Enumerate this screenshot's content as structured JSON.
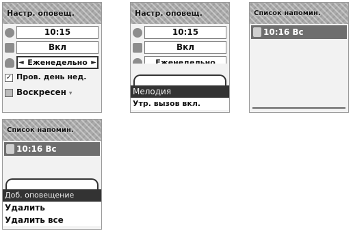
{
  "screens": {
    "s1": {
      "title": "Настр. оповещ.",
      "time": "10:15",
      "state": "Вкл",
      "repeat": "Еженедельно",
      "left_arrow": "◄",
      "right_arrow": "►",
      "check1_label": "Пров. день нед.",
      "check1_mark": "✓",
      "check2_label": "Воскресен"
    },
    "s2": {
      "title": "Настр. оповещ.",
      "time": "10:15",
      "state": "Вкл",
      "repeat_partial": "Еженедельно",
      "menu": [
        "Мелодия",
        "Утр. вызов вкл."
      ]
    },
    "s3": {
      "title": "Список напомин.",
      "item": "10:16 Вс"
    },
    "s4": {
      "title": "Список напомин.",
      "item": "10:16 Вс",
      "menu": [
        "Доб. оповещение",
        "Удалить",
        "Удалить все"
      ]
    }
  },
  "icons": [
    "clock-icon",
    "toggle-icon",
    "bell-icon",
    "reminder-icon"
  ],
  "colors": {
    "title_bar": "#a9a9a9",
    "highlight": "#333333",
    "list_item": "#6e6e6e"
  }
}
